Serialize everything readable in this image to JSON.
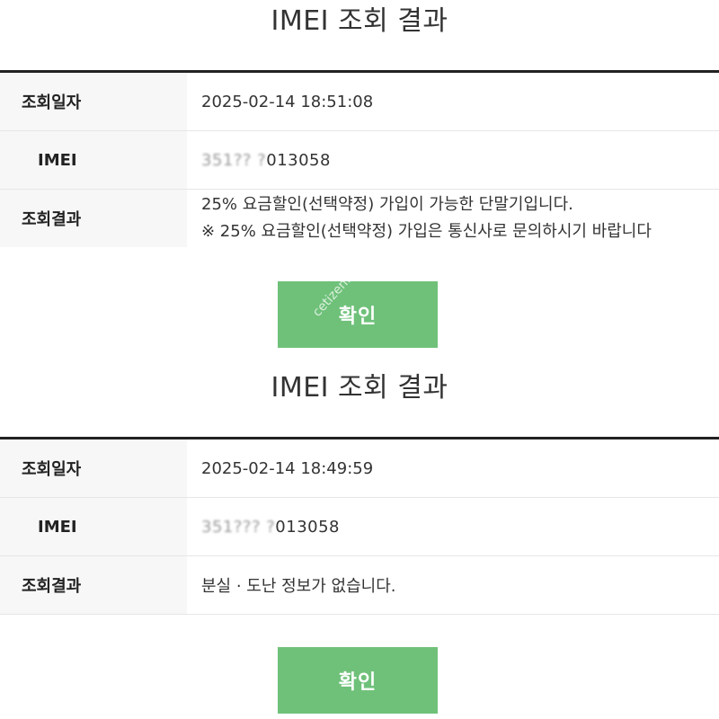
{
  "results": [
    {
      "title": "IMEI 조회 결과",
      "rows": [
        {
          "label": "조회일자",
          "value": "2025-02-14 18:51:08"
        },
        {
          "label": "IMEI",
          "value_masked": "351?? ?",
          "value_visible": "013058"
        },
        {
          "label": "조회결과",
          "lines": [
            "25% 요금할인(선택약정) 가입이 가능한 단말기입니다.",
            "※ 25% 요금할인(선택약정) 가입은 통신사로 문의하시기 바랍니다"
          ]
        }
      ],
      "button_label": "확인"
    },
    {
      "title": "IMEI 조회 결과",
      "rows": [
        {
          "label": "조회일자",
          "value": "2025-02-14 18:49:59"
        },
        {
          "label": "IMEI",
          "value_masked": "351??? ?",
          "value_visible": "013058"
        },
        {
          "label": "조회결과",
          "value": "분실 · 도난 정보가 없습니다."
        }
      ],
      "button_label": "확인"
    }
  ],
  "watermark": "cetizen.com",
  "colors": {
    "button": "#6fc17a",
    "label_bg": "#f7f7f7",
    "table_border": "#222222"
  }
}
